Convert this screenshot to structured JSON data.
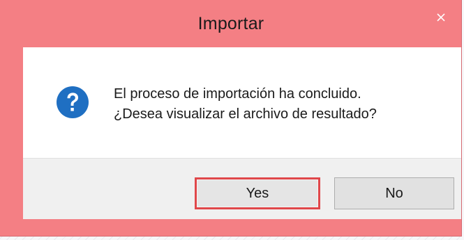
{
  "dialog": {
    "title": "Importar",
    "close_icon": "close-icon",
    "question_icon": "question-icon",
    "message_line1": "El proceso de importación ha concluido.",
    "message_line2": "¿Desea visualizar el archivo de resultado?",
    "yes_label": "Yes",
    "no_label": "No"
  },
  "colors": {
    "titlebar": "#f47f84",
    "icon_blue": "#1f6fc2",
    "focus_border": "#e0474a",
    "button_bar": "#f0f0f0"
  }
}
